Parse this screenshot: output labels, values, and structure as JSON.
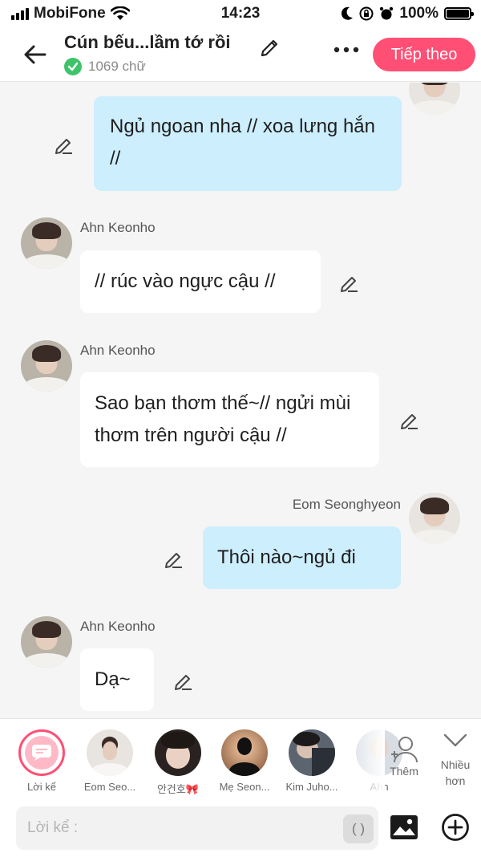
{
  "status_bar": {
    "carrier": "MobiFone",
    "time": "14:23",
    "battery": "100%",
    "battery_level": 1.0
  },
  "header": {
    "title": "Cún bếu...lầm tớ rồi",
    "word_count": "1069 chữ",
    "next_button": "Tiếp theo",
    "accent_color": "#ff4f74"
  },
  "messages": [
    {
      "type": "out",
      "text": "Ngủ ngoan nha // xoa lưng hắn //"
    },
    {
      "type": "in",
      "sender": "Ahn Keonho",
      "text": "// rúc vào ngực cậu //"
    },
    {
      "type": "in",
      "sender": "Ahn Keonho",
      "text": "Sao bạn thơm thế~// ngửi mùi thơm trên người cậu //"
    },
    {
      "type": "out",
      "sender": "Eom Seonghyeon",
      "text": "Thôi nào~ngủ đi"
    },
    {
      "type": "in",
      "sender": "Ahn Keonho",
      "text": "Dạ~"
    }
  ],
  "characters": [
    {
      "label": "Lời kể"
    },
    {
      "label": "Eom Seo..."
    },
    {
      "label": "안건호🎀"
    },
    {
      "label": "Mẹ Seon..."
    },
    {
      "label": "Kim Juho..."
    },
    {
      "label": "Ahn"
    }
  ],
  "actions": {
    "add": "Thêm",
    "more": "Nhiều hơn"
  },
  "input": {
    "placeholder": "Lời kể :",
    "paren_button": "( )"
  }
}
